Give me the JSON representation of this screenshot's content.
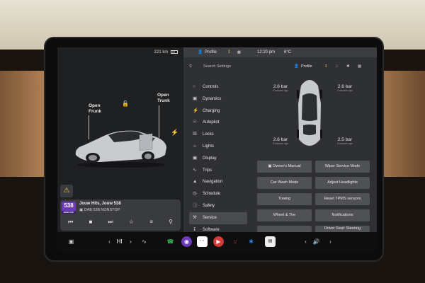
{
  "status": {
    "range": "221 km",
    "profile_label": "Profile",
    "time": "12:20 pm",
    "temperature": "6°C"
  },
  "car_view": {
    "open_frunk": "Open\nFrunk",
    "open_trunk": "Open\nTrunk"
  },
  "media": {
    "logo_number": "538",
    "logo_sub": "NONSTOP",
    "song": "Jouw Hits, Jouw 538",
    "station": "DAB 538 NONSTOP"
  },
  "settings": {
    "search_placeholder": "Search Settings",
    "profile_label": "Profile",
    "menu": [
      {
        "label": "Controls",
        "icon": "toggle-icon"
      },
      {
        "label": "Dynamics",
        "icon": "car-icon"
      },
      {
        "label": "Charging",
        "icon": "bolt-icon"
      },
      {
        "label": "Autopilot",
        "icon": "steering-wheel-icon"
      },
      {
        "label": "Locks",
        "icon": "lock-icon"
      },
      {
        "label": "Lights",
        "icon": "light-icon"
      },
      {
        "label": "Display",
        "icon": "display-icon"
      },
      {
        "label": "Trips",
        "icon": "trips-icon"
      },
      {
        "label": "Navigation",
        "icon": "navigation-icon"
      },
      {
        "label": "Schedule",
        "icon": "clock-icon"
      },
      {
        "label": "Safety",
        "icon": "safety-icon"
      },
      {
        "label": "Service",
        "icon": "wrench-icon",
        "active": true
      },
      {
        "label": "Software",
        "icon": "download-icon"
      }
    ],
    "tires": {
      "front_left": {
        "value": "2.6 bar",
        "age": "5 minutes ago"
      },
      "front_right": {
        "value": "2.6 bar",
        "age": "5 minutes ago"
      },
      "rear_left": {
        "value": "2.6 bar",
        "age": "5 minutes ago"
      },
      "rear_right": {
        "value": "2.5 bar",
        "age": "5 minutes ago"
      }
    },
    "buttons": [
      "Owner's Manual",
      "Wiper Service Mode",
      "Car Wash Mode",
      "Adjust Headlights",
      "Towing",
      "Reset TPMS sensors",
      "Wheel & Tire",
      "Notifications",
      "",
      "Driver Seat: Steering"
    ]
  },
  "taskbar": {
    "climate_value": "HI"
  },
  "colors": {
    "accent": "#e0b341",
    "purple": "#6d3ab8",
    "phone_green": "#3bc45a",
    "media_red": "#d33b34",
    "bluetooth_blue": "#2d7ed6"
  }
}
